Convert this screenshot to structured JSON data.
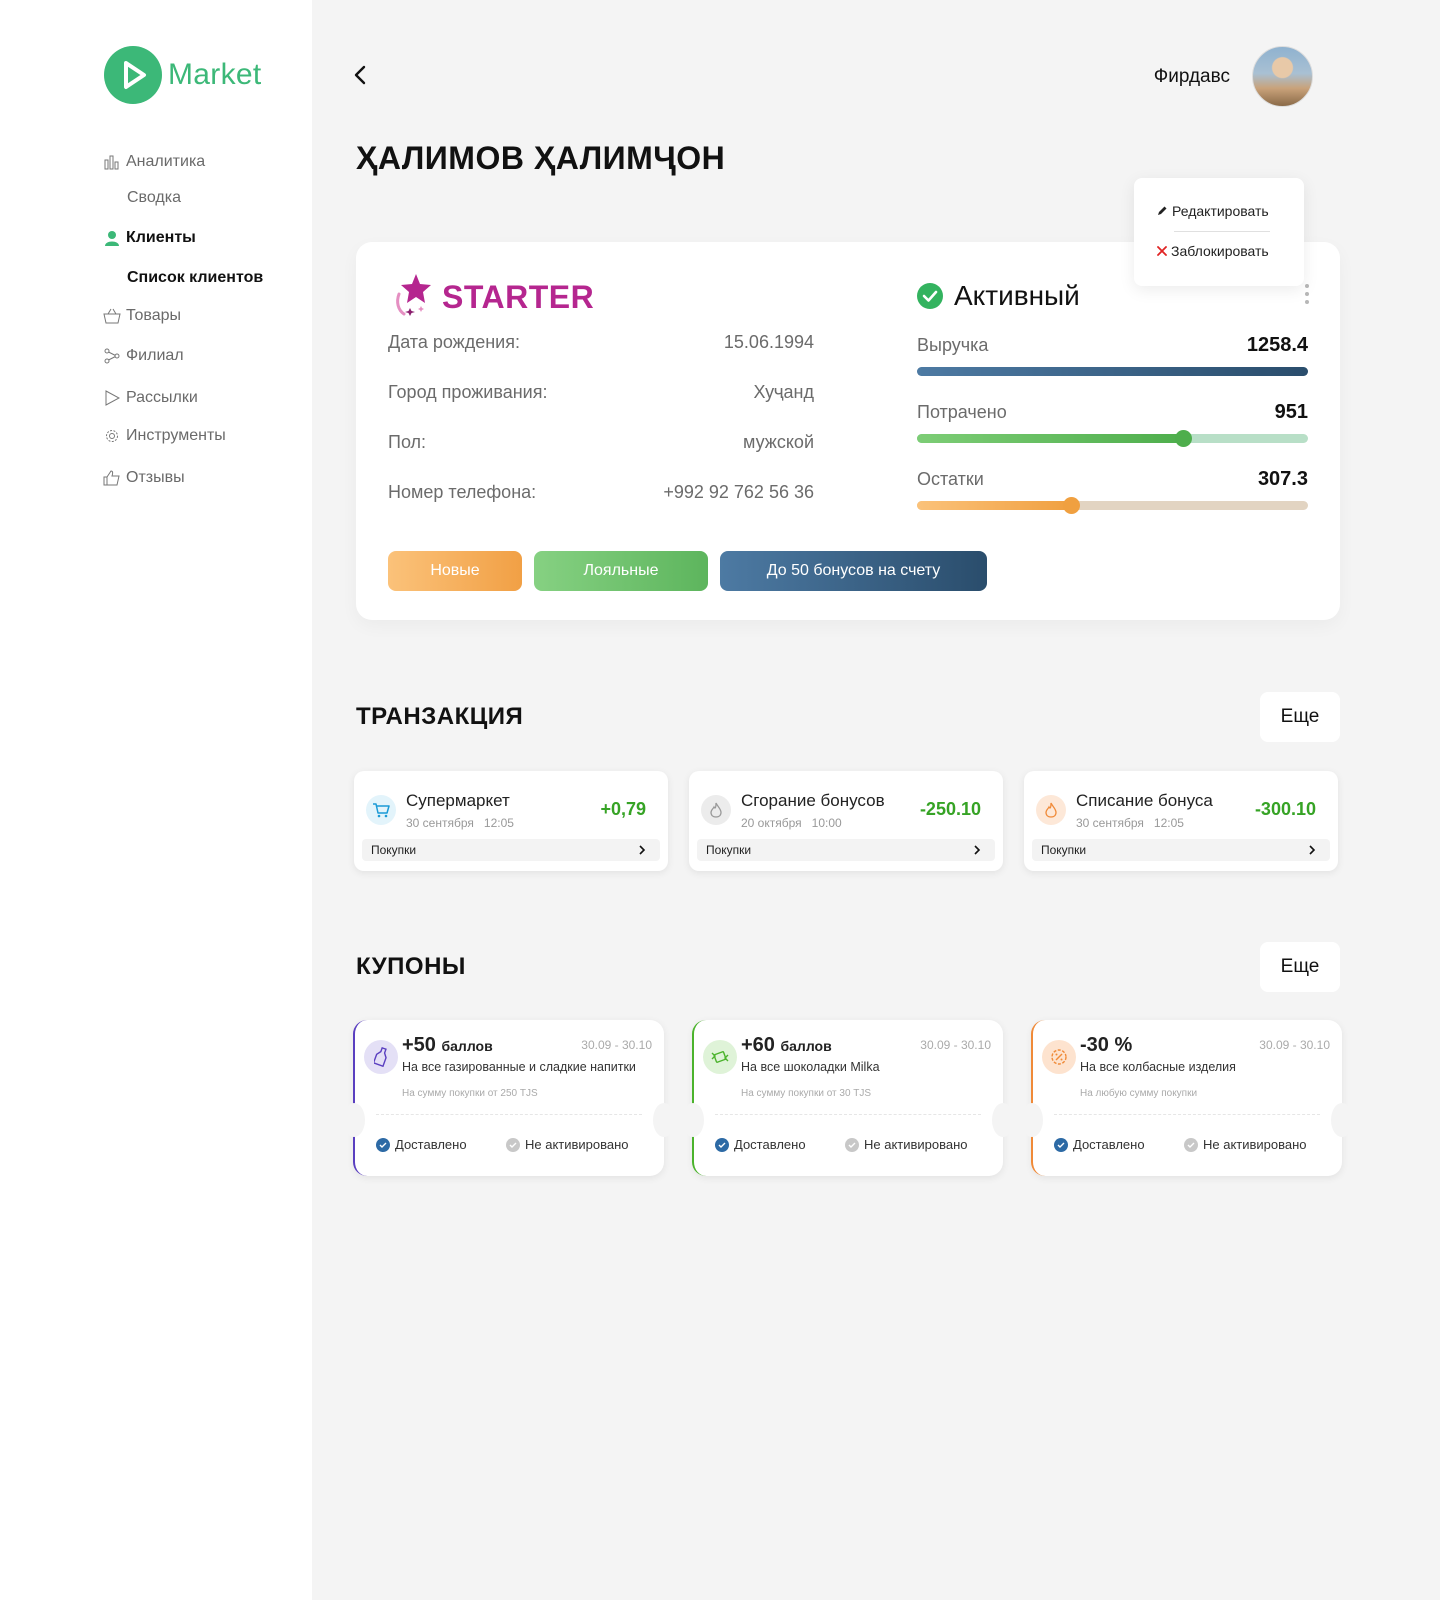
{
  "brand": {
    "name": "Market",
    "color": "#3cb878"
  },
  "sidebar": {
    "items": [
      {
        "label": "Аналитика",
        "icon": "chart-bars-icon"
      },
      {
        "label": "Сводка",
        "sub": true
      },
      {
        "label": "Клиенты",
        "icon": "user-icon",
        "active": true
      },
      {
        "label": "Список клиентов",
        "sub": true,
        "active": true
      },
      {
        "label": "Товары",
        "icon": "basket-icon"
      },
      {
        "label": "Филиал",
        "icon": "branch-icon"
      },
      {
        "label": "Рассылки",
        "icon": "send-icon"
      },
      {
        "label": "Инструменты",
        "icon": "gear-icon"
      },
      {
        "label": "Отзывы",
        "icon": "thumbs-up-icon"
      }
    ]
  },
  "header": {
    "user_name": "Фирдавс"
  },
  "page": {
    "title": "ҲАЛИМОВ ҲАЛИМҶОН"
  },
  "menu": {
    "edit": "Редактировать",
    "block": "Заблокировать"
  },
  "profile": {
    "tier": "STARTER",
    "tier_color": "#b5268f",
    "status": "Активный",
    "fields": [
      {
        "label": "Дата рождения:",
        "value": "15.06.1994"
      },
      {
        "label": "Город проживания:",
        "value": "Хуҷанд"
      },
      {
        "label": "Пол:",
        "value": "мужской"
      },
      {
        "label": "Номер телефона:",
        "value": "+992 92 762 56 36"
      }
    ],
    "metrics": [
      {
        "label": "Выручка",
        "value": "1258.4",
        "fill": 1.0
      },
      {
        "label": "Потрачено",
        "value": "951",
        "fill": 0.68
      },
      {
        "label": "Остатки",
        "value": "307.3",
        "fill": 0.395
      }
    ],
    "tags": [
      "Новые",
      "Лояльные",
      "До 50 бонусов на счету"
    ]
  },
  "transactions": {
    "title": "ТРАНЗАКЦИЯ",
    "more": "Еще",
    "items": [
      {
        "title": "Супермаркет",
        "date": "30 сентября",
        "time": "12:05",
        "amount": "+0,79",
        "category": "Покупки",
        "icon": "cart-icon"
      },
      {
        "title": "Сгорание бонусов",
        "date": "20 октября",
        "time": "10:00",
        "amount": "-250.10",
        "category": "Покупки",
        "icon": "flame-icon"
      },
      {
        "title": "Списание бонуса",
        "date": "30 сентября",
        "time": "12:05",
        "amount": "-300.10",
        "category": "Покупки",
        "icon": "flame-icon"
      }
    ]
  },
  "coupons": {
    "title": "КУПОНЫ",
    "more": "Еще",
    "items": [
      {
        "value": "+50",
        "unit": "баллов",
        "dates": "30.09 - 30.10",
        "desc": "На все газированные и сладкие напитки",
        "cond": "На сумму покупки от 250 TJS",
        "delivered": "Доставлено",
        "activated": "Не активировано",
        "accent": "#5a3fc0",
        "icon": "bottle-icon"
      },
      {
        "value": "+60",
        "unit": "баллов",
        "dates": "30.09 - 30.10",
        "desc": "На все шоколадки Milka",
        "cond": "На сумму покупки от 30 TJS",
        "delivered": "Доставлено",
        "activated": "Не активировано",
        "accent": "#4bb32c",
        "icon": "candy-icon"
      },
      {
        "value": "-30 %",
        "unit": "",
        "dates": "30.09 - 30.10",
        "desc": "На все колбасные изделия",
        "cond": "На любую сумму покупки",
        "delivered": "Доставлено",
        "activated": "Не активировано",
        "accent": "#f08a38",
        "icon": "discount-icon"
      }
    ]
  }
}
